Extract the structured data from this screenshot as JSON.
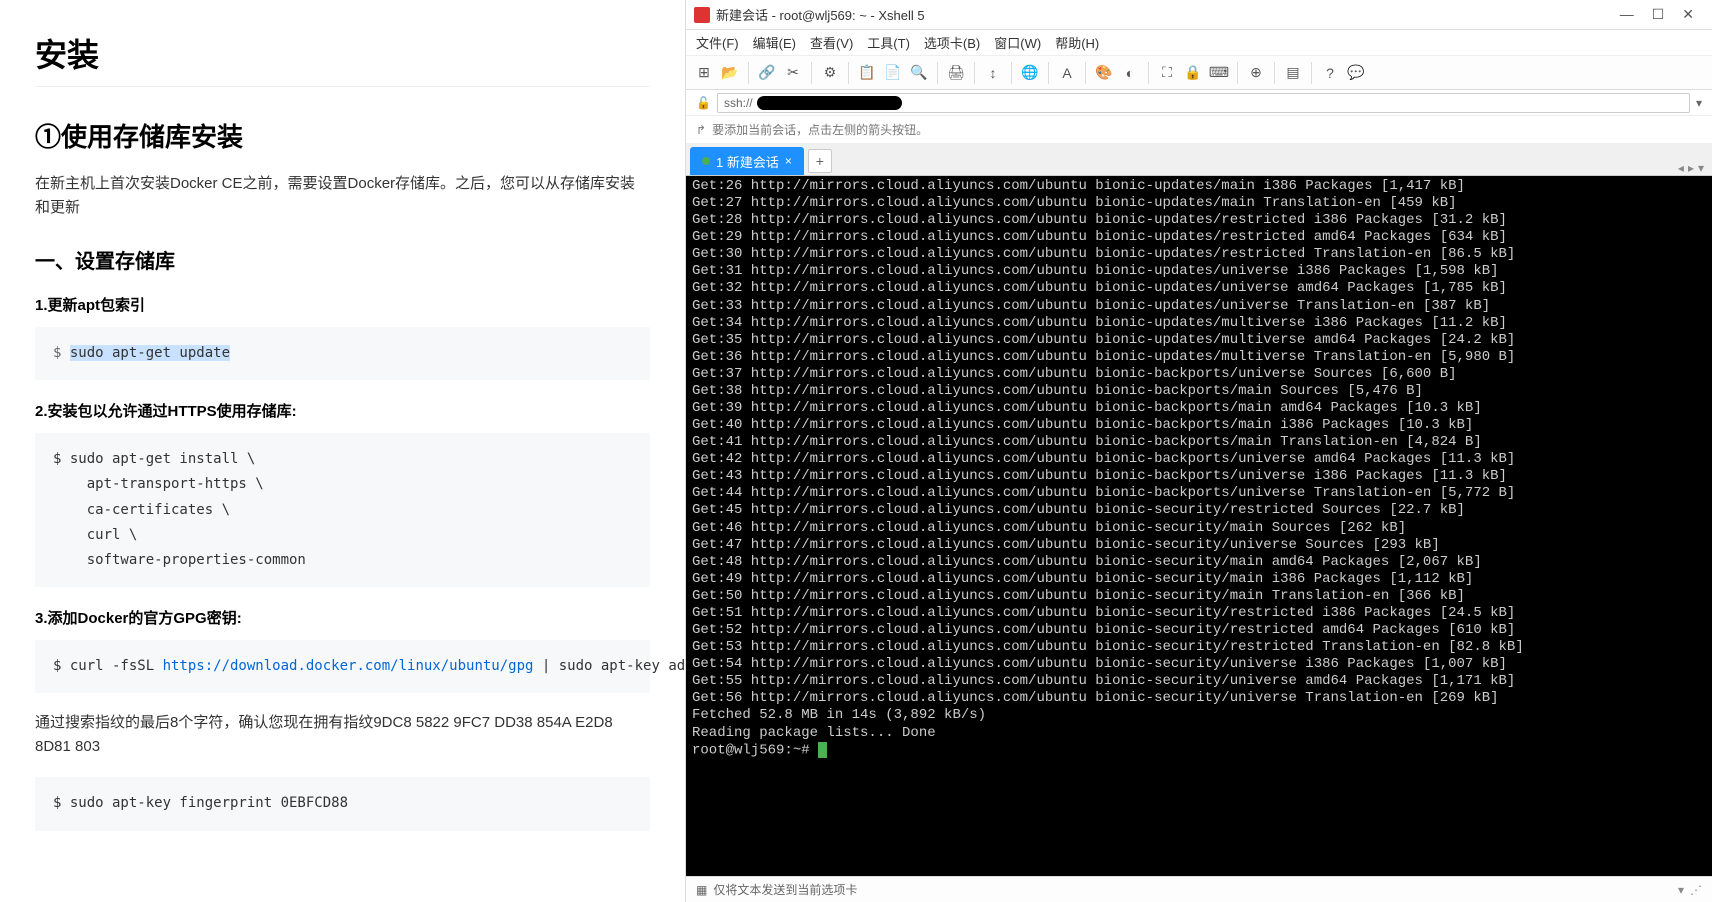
{
  "doc": {
    "h1": "安装",
    "h2": "①使用存储库安装",
    "para1": "在新主机上首次安装Docker CE之前，需要设置Docker存储库。之后，您可以从存储库安装和更新",
    "h3": "一、设置存储库",
    "item1": "1.更新apt包索引",
    "code1": "$ sudo apt-get update",
    "item2": "2.安装包以允许通过HTTPS使用存储库:",
    "code2": "$ sudo apt-get install \\\n    apt-transport-https \\\n    ca-certificates \\\n    curl \\\n    software-properties-common",
    "item3": "3.添加Docker的官方GPG密钥:",
    "code3_prefix": "$ curl -fsSL ",
    "code3_url": "https://download.docker.com/linux/ubuntu/gpg",
    "code3_suffix": " | sudo apt-key add",
    "para2": "通过搜索指纹的最后8个字符，确认您现在拥有指纹9DC8 5822 9FC7 DD38 854A E2D8 8D81 803",
    "code4": "$ sudo apt-key fingerprint 0EBFCD88"
  },
  "xshell": {
    "title": "新建会话 - root@wlj569: ~ - Xshell 5",
    "menu": [
      "文件(F)",
      "编辑(E)",
      "查看(V)",
      "工具(T)",
      "选项卡(B)",
      "窗口(W)",
      "帮助(H)"
    ],
    "address_prefix": "ssh://",
    "hint_icon": "↱",
    "hint_text": "要添加当前会话，点击左侧的箭头按钮。",
    "tab_label": "1 新建会话",
    "status_text": "仅将文本发送到当前选项卡",
    "terminal_lines": [
      "Get:26 http://mirrors.cloud.aliyuncs.com/ubuntu bionic-updates/main i386 Packages [1,417 kB]",
      "Get:27 http://mirrors.cloud.aliyuncs.com/ubuntu bionic-updates/main Translation-en [459 kB]",
      "Get:28 http://mirrors.cloud.aliyuncs.com/ubuntu bionic-updates/restricted i386 Packages [31.2 kB]",
      "Get:29 http://mirrors.cloud.aliyuncs.com/ubuntu bionic-updates/restricted amd64 Packages [634 kB]",
      "Get:30 http://mirrors.cloud.aliyuncs.com/ubuntu bionic-updates/restricted Translation-en [86.5 kB]",
      "Get:31 http://mirrors.cloud.aliyuncs.com/ubuntu bionic-updates/universe i386 Packages [1,598 kB]",
      "Get:32 http://mirrors.cloud.aliyuncs.com/ubuntu bionic-updates/universe amd64 Packages [1,785 kB]",
      "Get:33 http://mirrors.cloud.aliyuncs.com/ubuntu bionic-updates/universe Translation-en [387 kB]",
      "Get:34 http://mirrors.cloud.aliyuncs.com/ubuntu bionic-updates/multiverse i386 Packages [11.2 kB]",
      "Get:35 http://mirrors.cloud.aliyuncs.com/ubuntu bionic-updates/multiverse amd64 Packages [24.2 kB]",
      "Get:36 http://mirrors.cloud.aliyuncs.com/ubuntu bionic-updates/multiverse Translation-en [5,980 B]",
      "Get:37 http://mirrors.cloud.aliyuncs.com/ubuntu bionic-backports/universe Sources [6,600 B]",
      "Get:38 http://mirrors.cloud.aliyuncs.com/ubuntu bionic-backports/main Sources [5,476 B]",
      "Get:39 http://mirrors.cloud.aliyuncs.com/ubuntu bionic-backports/main amd64 Packages [10.3 kB]",
      "Get:40 http://mirrors.cloud.aliyuncs.com/ubuntu bionic-backports/main i386 Packages [10.3 kB]",
      "Get:41 http://mirrors.cloud.aliyuncs.com/ubuntu bionic-backports/main Translation-en [4,824 B]",
      "Get:42 http://mirrors.cloud.aliyuncs.com/ubuntu bionic-backports/universe amd64 Packages [11.3 kB]",
      "Get:43 http://mirrors.cloud.aliyuncs.com/ubuntu bionic-backports/universe i386 Packages [11.3 kB]",
      "Get:44 http://mirrors.cloud.aliyuncs.com/ubuntu bionic-backports/universe Translation-en [5,772 B]",
      "Get:45 http://mirrors.cloud.aliyuncs.com/ubuntu bionic-security/restricted Sources [22.7 kB]",
      "Get:46 http://mirrors.cloud.aliyuncs.com/ubuntu bionic-security/main Sources [262 kB]",
      "Get:47 http://mirrors.cloud.aliyuncs.com/ubuntu bionic-security/universe Sources [293 kB]",
      "Get:48 http://mirrors.cloud.aliyuncs.com/ubuntu bionic-security/main amd64 Packages [2,067 kB]",
      "Get:49 http://mirrors.cloud.aliyuncs.com/ubuntu bionic-security/main i386 Packages [1,112 kB]",
      "Get:50 http://mirrors.cloud.aliyuncs.com/ubuntu bionic-security/main Translation-en [366 kB]",
      "Get:51 http://mirrors.cloud.aliyuncs.com/ubuntu bionic-security/restricted i386 Packages [24.5 kB]",
      "Get:52 http://mirrors.cloud.aliyuncs.com/ubuntu bionic-security/restricted amd64 Packages [610 kB]",
      "Get:53 http://mirrors.cloud.aliyuncs.com/ubuntu bionic-security/restricted Translation-en [82.8 kB]",
      "Get:54 http://mirrors.cloud.aliyuncs.com/ubuntu bionic-security/universe i386 Packages [1,007 kB]",
      "Get:55 http://mirrors.cloud.aliyuncs.com/ubuntu bionic-security/universe amd64 Packages [1,171 kB]",
      "Get:56 http://mirrors.cloud.aliyuncs.com/ubuntu bionic-security/universe Translation-en [269 kB]",
      "Fetched 52.8 MB in 14s (3,892 kB/s)",
      "Reading package lists... Done"
    ],
    "prompt": "root@wlj569:~# "
  }
}
